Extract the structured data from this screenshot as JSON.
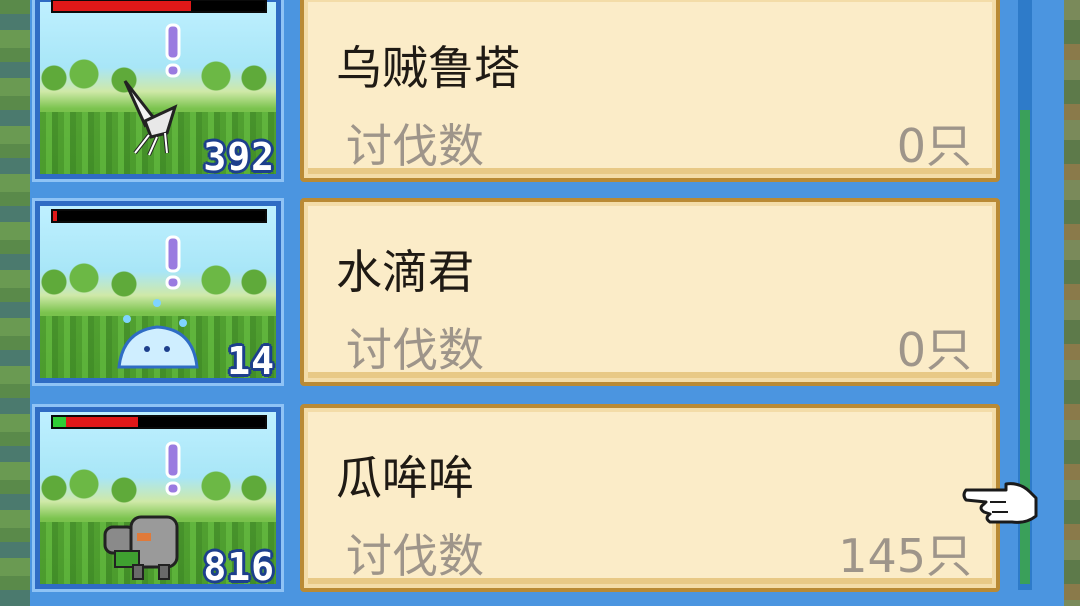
{
  "list": {
    "rows": [
      {
        "name": "乌贼鲁塔",
        "kill_label": "讨伐数",
        "kill_count": "0只",
        "level": "392",
        "hp_fraction": 0.65,
        "hp_colors": {
          "fill": "#e01818",
          "empty": "#000000"
        },
        "monster_icon": "white-squid-icon"
      },
      {
        "name": "水滴君",
        "kill_label": "讨伐数",
        "kill_count": "0只",
        "level": "14",
        "hp_fraction": 0.02,
        "hp_colors": {
          "fill": "#e01818",
          "empty": "#000000"
        },
        "monster_icon": "blue-slime-icon"
      },
      {
        "name": "瓜哞哞",
        "kill_label": "讨伐数",
        "kill_count": "145只",
        "level": "816",
        "hp_fraction": 0.4,
        "hp_green_fraction": 0.06,
        "hp_colors": {
          "fill": "#e01818",
          "green": "#2fcc35",
          "empty": "#000000"
        },
        "monster_icon": "grey-cow-icon"
      }
    ]
  },
  "colors": {
    "panel_bg": "#4b95e0",
    "card_bg": "#fbecc8",
    "card_border": "#b98a35",
    "name_text": "#1f1a14",
    "label_text": "#9e958a",
    "level_outline": "#1d3f8c"
  },
  "cursor": {
    "icon": "pointing-hand-icon"
  }
}
